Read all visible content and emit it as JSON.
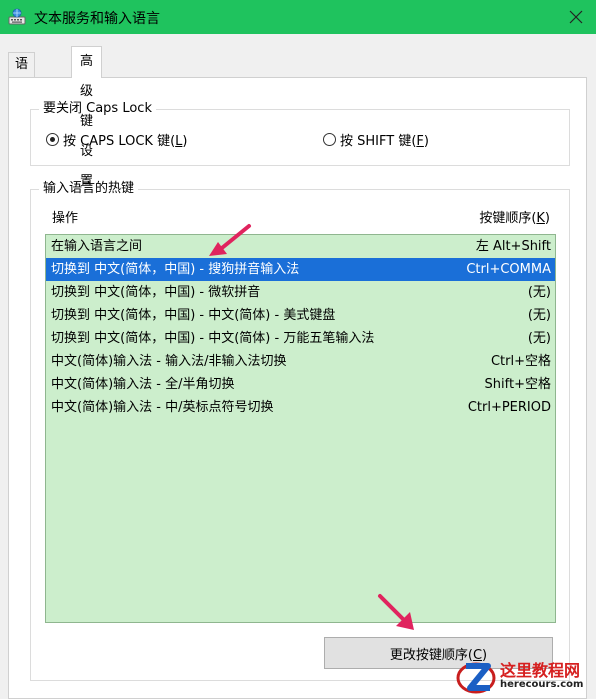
{
  "window": {
    "title": "文本服务和输入语言",
    "close_icon": "close-icon"
  },
  "tabs": [
    {
      "label": "语言栏",
      "active": false
    },
    {
      "label": "高级键设置",
      "active": true
    }
  ],
  "caps_lock": {
    "legend": "要关闭 Caps Lock",
    "option1": {
      "label": "按 CAPS LOCK 键(",
      "key": "L",
      "end": ")",
      "checked": true
    },
    "option2": {
      "label": "按 SHIFT 键(",
      "key": "F",
      "end": ")",
      "checked": false
    }
  },
  "hotkeys": {
    "legend": "输入语言的热键",
    "col_action": "操作",
    "col_order": "按键顺序(",
    "col_order_key": "K",
    "col_order_end": ")",
    "rows": [
      {
        "action": "在输入语言之间",
        "keys": "左 Alt+Shift"
      },
      {
        "action": "切换到 中文(简体，中国) - 搜狗拼音输入法",
        "keys": "Ctrl+COMMA",
        "selected": true
      },
      {
        "action": "切换到 中文(简体，中国) - 微软拼音",
        "keys": "(无)"
      },
      {
        "action": "切换到 中文(简体，中国) - 中文(简体) - 美式键盘",
        "keys": "(无)"
      },
      {
        "action": "切换到 中文(简体，中国) - 中文(简体) - 万能五笔输入法",
        "keys": "(无)"
      },
      {
        "action": "中文(简体)输入法 - 输入法/非输入法切换",
        "keys": "Ctrl+空格"
      },
      {
        "action": "中文(简体)输入法 - 全/半角切换",
        "keys": "Shift+空格"
      },
      {
        "action": "中文(简体)输入法 - 中/英标点符号切换",
        "keys": "Ctrl+PERIOD"
      }
    ],
    "change_button": {
      "label": "更改按键顺序(",
      "key": "C",
      "end": ")"
    }
  },
  "watermark": {
    "title": "这里教程网",
    "url": "herecours.com"
  },
  "colors": {
    "titlebar": "#1fc35e",
    "list_bg": "#cceecc",
    "selection": "#1a6fd8",
    "arrow": "#e0245e"
  }
}
